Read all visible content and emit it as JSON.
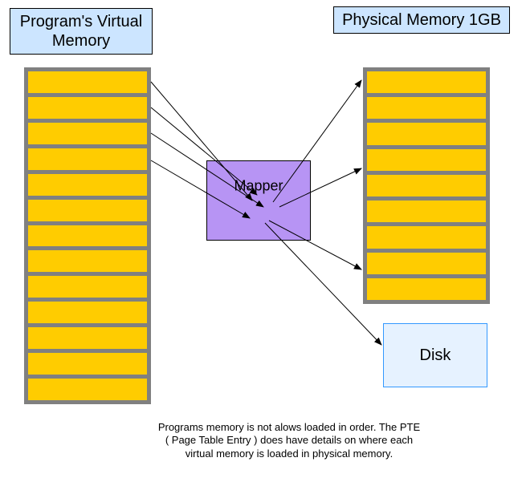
{
  "titles": {
    "virtual": "Program's Virtual Memory",
    "physical": "Physical Memory 1GB"
  },
  "mapper": {
    "label": "Mapper"
  },
  "disk": {
    "label": "Disk"
  },
  "caption": {
    "line1": "Programs memory is not alows loaded in order. The PTE",
    "line2": "( Page Table Entry ) does have details on where each",
    "line3": "virtual memory is loaded in physical memory."
  },
  "virtual_rows": 13,
  "physical_rows": 9,
  "colors": {
    "title_bg": "#cce5ff",
    "mem_bg": "#ffcc00",
    "block_bg": "#808080",
    "mapper_bg": "#b794f4",
    "disk_bg": "#e6f2ff",
    "disk_border": "#3399ff"
  }
}
